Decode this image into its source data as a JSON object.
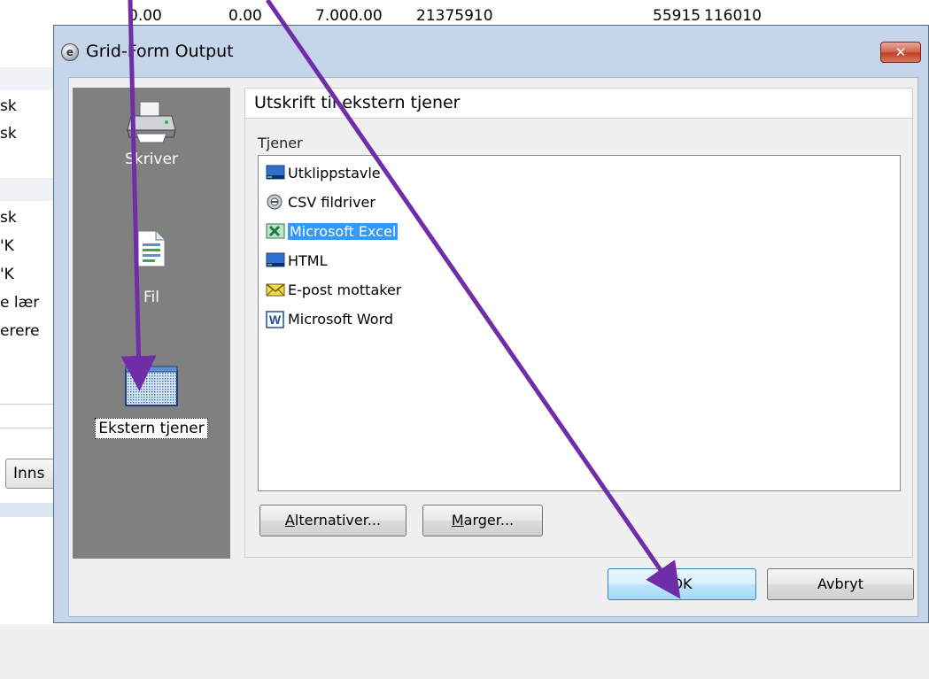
{
  "background": {
    "top_row": [
      "0.00",
      "0.00",
      "7.000.00",
      "21375910",
      "55915",
      "116010"
    ],
    "left_cells": [
      "sk",
      "sk",
      "sk",
      "'K",
      "'K",
      "e lær",
      "erere"
    ],
    "inns_button": "Inns"
  },
  "dialog": {
    "title": "Grid-Form Output",
    "close_glyph": "✕",
    "side_items": [
      {
        "label": "Skriver",
        "icon": "printer-icon"
      },
      {
        "label": "Fil",
        "icon": "file-icon"
      },
      {
        "label": "Ekstern tjener",
        "icon": "server-icon",
        "selected": true
      }
    ],
    "panel_header": "Utskrift til ekstern tjener",
    "list_label": "Tjener",
    "servers": [
      {
        "label": "Utklippstavle",
        "icon": "clipboard-icon"
      },
      {
        "label": "CSV fildriver",
        "icon": "csv-icon"
      },
      {
        "label": "Microsoft Excel",
        "icon": "excel-icon",
        "selected": true
      },
      {
        "label": "HTML",
        "icon": "html-icon"
      },
      {
        "label": "E-post mottaker",
        "icon": "email-icon"
      },
      {
        "label": "Microsoft Word",
        "icon": "word-icon"
      }
    ],
    "buttons": {
      "options": {
        "accel": "A",
        "rest": "lternativer..."
      },
      "margins": {
        "accel": "M",
        "rest": "arger..."
      },
      "ok": "OK",
      "cancel": "Avbryt"
    }
  },
  "colors": {
    "selection": "#3399ff",
    "annotation_arrow": "#6f2da8",
    "side_panel": "#808080"
  }
}
